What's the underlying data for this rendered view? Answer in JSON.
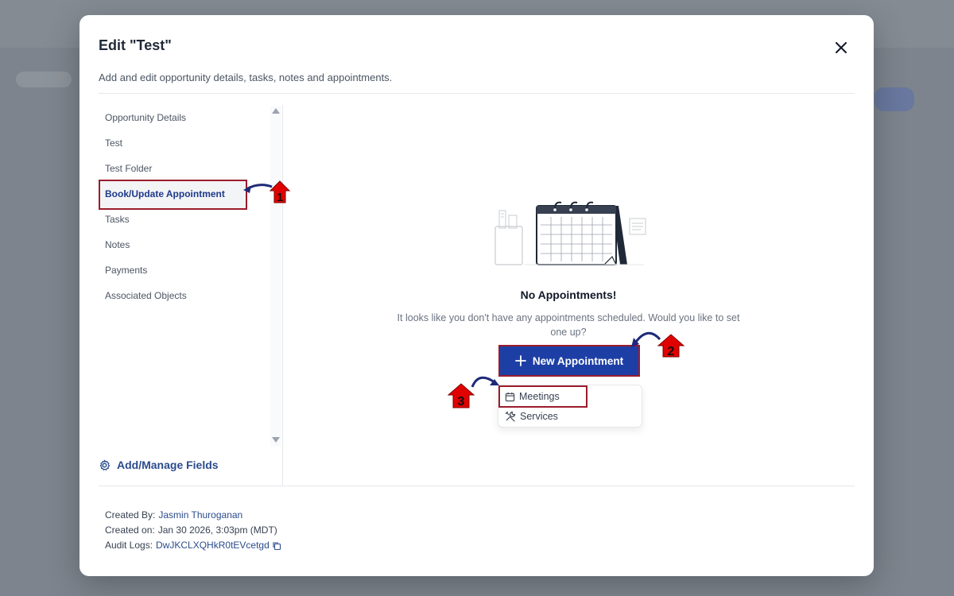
{
  "modal": {
    "title": "Edit \"Test\"",
    "subtitle": "Add and edit opportunity details, tasks, notes and appointments."
  },
  "sidebar": {
    "items": [
      {
        "label": "Opportunity Details"
      },
      {
        "label": "Test"
      },
      {
        "label": "Test Folder"
      },
      {
        "label": "Book/Update Appointment"
      },
      {
        "label": "Tasks"
      },
      {
        "label": "Notes"
      },
      {
        "label": "Payments"
      },
      {
        "label": "Associated Objects"
      }
    ],
    "manage_fields": "Add/Manage Fields"
  },
  "empty_state": {
    "title": "No Appointments!",
    "text": "It looks like you don't have any appointments scheduled. Would you like to set one up?",
    "button": "New Appointment"
  },
  "dropdown": {
    "items": [
      {
        "label": "Meetings",
        "icon": "calendar-icon"
      },
      {
        "label": "Services",
        "icon": "tools-icon"
      }
    ]
  },
  "footer": {
    "created_by_label": "Created By:",
    "created_by": "Jasmin Thuroganan",
    "created_on_label": "Created on:",
    "created_on": "Jan 30 2026, 3:03pm (MDT)",
    "audit_label": "Audit Logs:",
    "audit_id": "DwJKCLXQHkR0tEVcetgd"
  },
  "steps": [
    "1",
    "2",
    "3"
  ],
  "colors": {
    "primary": "#1d3fa5",
    "highlight": "#9b1c2c",
    "step_marker": "#e00000",
    "link": "#2b4c8c"
  }
}
